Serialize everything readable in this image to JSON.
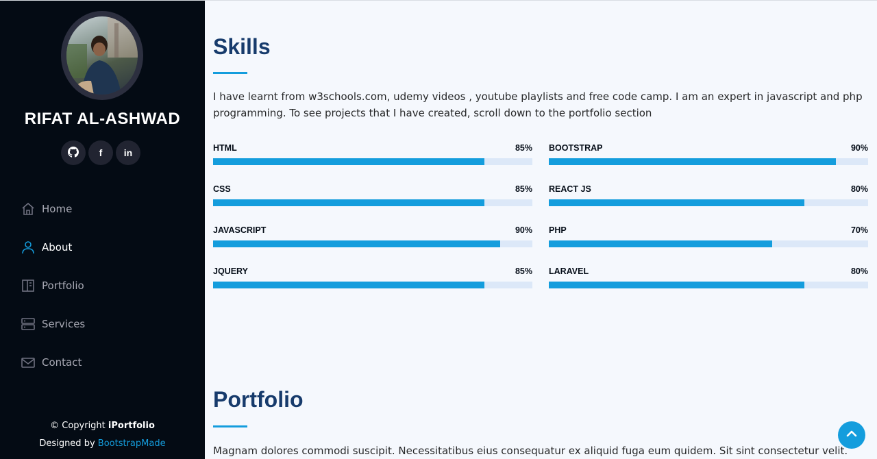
{
  "sidebar": {
    "name": "RIFAT AL-ASHWAD",
    "social": [
      {
        "icon": "github-icon",
        "label": ""
      },
      {
        "icon": "facebook-icon",
        "label": "f"
      },
      {
        "icon": "linkedin-icon",
        "label": "in"
      }
    ],
    "nav": [
      {
        "icon": "home-icon",
        "label": "Home",
        "active": false
      },
      {
        "icon": "user-icon",
        "label": "About",
        "active": true
      },
      {
        "icon": "portfolio-icon",
        "label": "Portfolio",
        "active": false
      },
      {
        "icon": "server-icon",
        "label": "Services",
        "active": false
      },
      {
        "icon": "envelope-icon",
        "label": "Contact",
        "active": false
      }
    ],
    "footer": {
      "copyright_prefix": "© Copyright ",
      "copyright_brand": "iPortfolio",
      "designed_prefix": "Designed by ",
      "designed_link": "BootstrapMade"
    }
  },
  "skills": {
    "title": "Skills",
    "intro": "I have learnt from w3schools.com, udemy videos , youtube playlists and free code camp. I am an expert in javascript and php programming. To see projects that I have created, scroll down to the portfolio section",
    "left": [
      {
        "name": "HTML",
        "value_label": "85%",
        "percent": 85
      },
      {
        "name": "CSS",
        "value_label": "85%",
        "percent": 85
      },
      {
        "name": "JAVASCRIPT",
        "value_label": "90%",
        "percent": 90
      },
      {
        "name": "JQUERY",
        "value_label": "85%",
        "percent": 85
      }
    ],
    "right": [
      {
        "name": "BOOTSTRAP",
        "value_label": "90%",
        "percent": 90
      },
      {
        "name": "REACT JS",
        "value_label": "80%",
        "percent": 80
      },
      {
        "name": "PHP",
        "value_label": "70%",
        "percent": 70
      },
      {
        "name": "LARAVEL",
        "value_label": "80%",
        "percent": 80
      }
    ]
  },
  "portfolio": {
    "title": "Portfolio",
    "description": "Magnam dolores commodi suscipit. Necessitatibus eius consequatur ex aliquid fuga eum quidem. Sit sint consectetur velit."
  },
  "colors": {
    "accent": "#149ddd",
    "sidebar_bg": "#040b14",
    "heading": "#173b6c"
  },
  "back_to_top_icon": "chevron-up-icon"
}
